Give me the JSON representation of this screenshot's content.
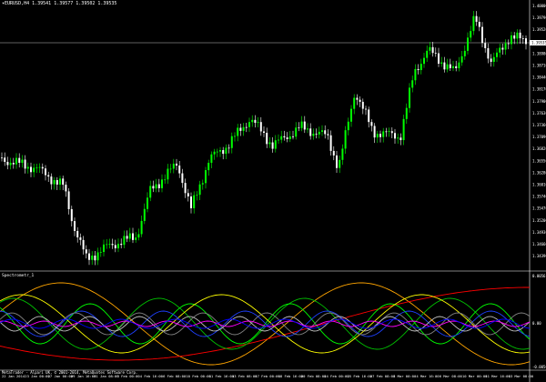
{
  "header": {
    "symbol": "EURUSD,H4",
    "ohlc": "1.39541 1.39577 1.39502 1.39535"
  },
  "current_price": "1.39535",
  "price_scale": [
    "1.40000",
    "1.39790",
    "1.39520",
    "1.39250",
    "1.38980",
    "1.38710",
    "1.38440",
    "1.38170",
    "1.37900",
    "1.37630",
    "1.37360",
    "1.37090",
    "1.36820",
    "1.36550",
    "1.36280",
    "1.36010",
    "1.35740",
    "1.35470",
    "1.35200",
    "1.34930",
    "1.34660",
    "1.34390"
  ],
  "indicator": {
    "title": "Spectrometr_1",
    "top_value": "0.0056",
    "mid_value": "0.00",
    "bottom_value": "-0.0056"
  },
  "footer": "MetaTrader - Alpari UK, © 2001-2014, MetaQuotes Software Corp.",
  "dates": [
    "22 Jan 2014",
    "23 Jan 00:00",
    "27 Jan 00:00",
    "29 Jan 16:00",
    "31 Jan 08:00",
    "3 Feb 00:00",
    "4 Feb 16:00",
    "6 Feb 08:00",
    "10 Feb 00:00",
    "11 Feb 16:00",
    "13 Feb 08:00",
    "17 Feb 00:00",
    "18 Feb 16:00",
    "20 Feb 08:00",
    "24 Feb 00:00",
    "25 Feb 16:00",
    "27 Feb 08:00",
    "3 Mar 00:00",
    "4 Mar 16:00",
    "6 Mar 08:00",
    "10 Mar 00:00",
    "11 Mar 16:00",
    "13 Mar 08:00"
  ],
  "colors": {
    "bull": "#00ff00",
    "bear": "#ffffff",
    "price_line": "#c0c0c0",
    "spec": [
      "#ffa500",
      "#ff0000",
      "#00c000",
      "#00ff00",
      "#ffff00",
      "#1e40ff",
      "#808080",
      "#c0c0c0",
      "#ff00ff",
      "#0000ff"
    ]
  }
}
